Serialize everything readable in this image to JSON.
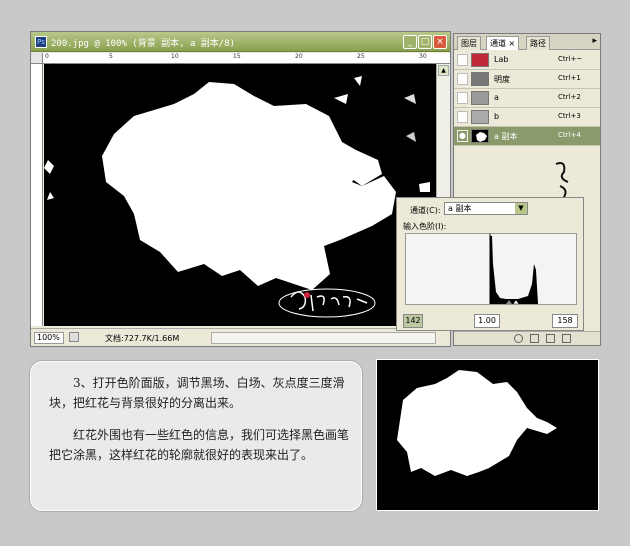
{
  "document": {
    "title": "200.jpg @ 100% (背景 副本, a 副本/8)",
    "zoom": "100%",
    "doc_info": "文档:727.7K/1.66M",
    "ruler_ticks": [
      "0",
      "5",
      "10",
      "15",
      "20",
      "25",
      "30"
    ]
  },
  "channels_panel": {
    "tabs": [
      "图层",
      "通道",
      "路径"
    ],
    "tab_close": "×",
    "menu_icon": "▸",
    "rows": [
      {
        "name": "Lab",
        "shortcut": "Ctrl+~"
      },
      {
        "name": "明度",
        "shortcut": "Ctrl+1"
      },
      {
        "name": "a",
        "shortcut": "Ctrl+2"
      },
      {
        "name": "b",
        "shortcut": "Ctrl+3"
      },
      {
        "name": "a 副本",
        "shortcut": "Ctrl+4"
      }
    ]
  },
  "levels": {
    "channel_label": "通道(C):",
    "channel_value": "a 副本",
    "input_label": "输入色阶(I):",
    "black_point": "142",
    "gamma": "1.00",
    "white_point": "158"
  },
  "caption": {
    "paragraph1": "3、打开色阶面版，调节黑场、白场、灰点度三度滑块，把红花与背景很好的分离出来。",
    "paragraph2": "红花外围也有一些红色的信息，我们可选择黑色画笔把它涂黑，这样红花的轮廓就很好的表现来出了。"
  },
  "colors": {
    "titlebar": "#9aae5c",
    "selected_row": "#8a9a6a",
    "background": "#c9c9c9"
  }
}
